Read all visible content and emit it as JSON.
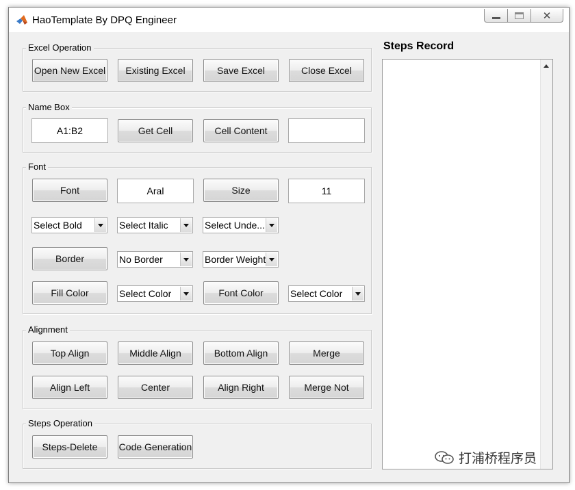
{
  "window": {
    "title": "HaoTemplate By DPQ Engineer",
    "icons": {
      "app": "matlab-logo-icon",
      "minimize": "minimize-icon",
      "maximize": "maximize-icon",
      "close": "close-icon"
    },
    "close_glyph": "✕"
  },
  "excel_operation": {
    "title": "Excel Operation",
    "buttons": [
      "Open New Excel",
      "Existing Excel",
      "Save Excel",
      "Close Excel"
    ]
  },
  "name_box": {
    "title": "Name Box",
    "range_value": "A1:B2",
    "get_cell_label": "Get Cell",
    "cell_content_label": "Cell Content",
    "content_value": ""
  },
  "font": {
    "title": "Font",
    "font_label": "Font",
    "font_value": "Aral",
    "size_label": "Size",
    "size_value": "11",
    "bold_select": "Select Bold",
    "italic_select": "Select Italic",
    "underline_select": "Select Unde...",
    "border_label": "Border",
    "border_select": "No Border",
    "border_weight_select": "Border Weight",
    "fill_color_label": "Fill Color",
    "fill_color_select": "Select Color",
    "font_color_label": "Font Color",
    "font_color_select": "Select Color"
  },
  "alignment": {
    "title": "Alignment",
    "buttons": [
      "Top Align",
      "Middle Align",
      "Bottom Align",
      "Merge",
      "Align Left",
      "Center",
      "Align Right",
      "Merge Not"
    ]
  },
  "steps_operation": {
    "title": "Steps Operation",
    "delete_label": "Steps-Delete",
    "codegen_label": "Code Generation"
  },
  "steps_record": {
    "title": "Steps Record",
    "items": []
  },
  "watermark": {
    "icon": "wechat-icon",
    "text": "打浦桥程序员"
  }
}
